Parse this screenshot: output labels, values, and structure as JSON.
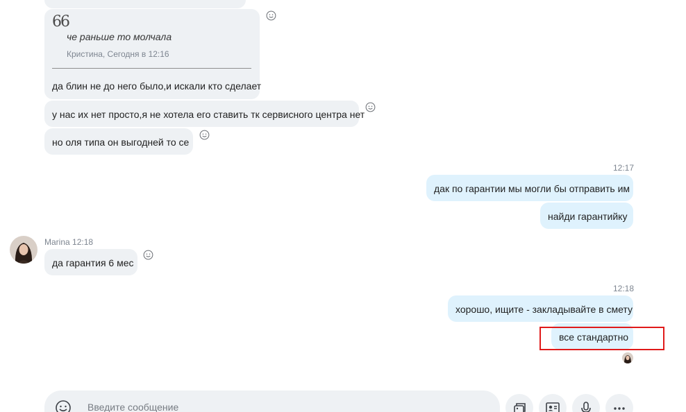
{
  "messages": {
    "quote_block": {
      "quote_icon": "quote-icon",
      "quoted_text": "че раньше то молчала",
      "quoted_meta": "Кристина, Сегодня в 12:16",
      "reply_text": "да блин не до него было,и искали кто сделает"
    },
    "incoming_1": "у нас их нет просто,я не хотела его ставить тк сервисного центра нет",
    "incoming_2": "но оля типа он выгодней то се",
    "outgoing_group_1": {
      "time": "12:17",
      "msg_1": "дак по гарантии мы могли бы отправить им",
      "msg_2": "найди гарантийку"
    },
    "marina": {
      "sender_line": "Marina 12:18",
      "msg": "да гарантия 6 мес"
    },
    "outgoing_group_2": {
      "time": "12:18",
      "msg_1": "хорошо, ищите - закладывайте в смету",
      "msg_2": "все стандартно"
    }
  },
  "composer": {
    "placeholder": "Введите сообщение",
    "icons": [
      "emoji-icon",
      "gallery-icon",
      "contact-card-icon",
      "microphone-icon",
      "more-icon"
    ]
  },
  "colors": {
    "incoming_bubble": "#eef1f4",
    "outgoing_bubble": "#dff2fd",
    "highlight_box": "#e01a1a"
  }
}
